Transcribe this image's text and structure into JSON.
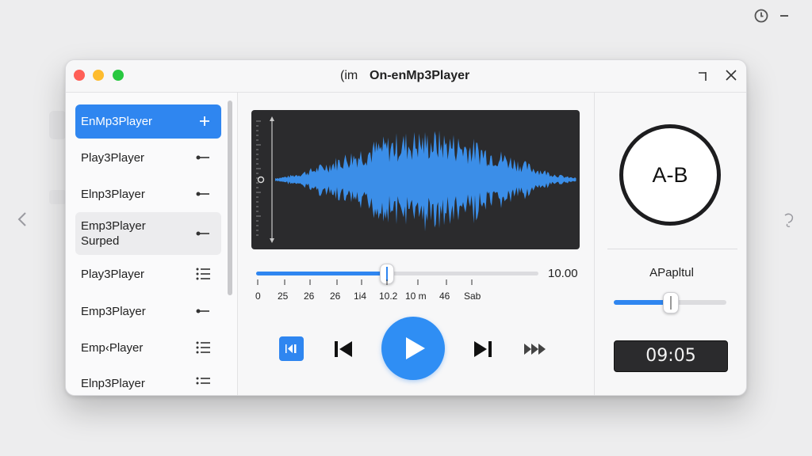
{
  "window": {
    "title_prefix": "(im",
    "title": "On-enMp3Player"
  },
  "sidebar": {
    "items": [
      {
        "label": "EnMp3Player",
        "icon": "plus-icon",
        "state": "active"
      },
      {
        "label": "Play3Player",
        "icon": "dash-dot-icon",
        "state": "normal"
      },
      {
        "label": "Elnp3Player",
        "icon": "dash-dot-icon",
        "state": "normal"
      },
      {
        "label": "Emp3Player\nSurped",
        "icon": "dash-dot-icon",
        "state": "hover"
      },
      {
        "label": "Play3Player",
        "icon": "list-icon",
        "state": "normal"
      },
      {
        "label": "Emp3Player",
        "icon": "dash-dot-icon",
        "state": "normal"
      },
      {
        "label": "Emp‹Player",
        "icon": "list-icon",
        "state": "normal"
      },
      {
        "label": "Elnp3Player",
        "icon": "list-icon",
        "state": "normal"
      }
    ]
  },
  "player": {
    "seek_time": "10.00",
    "seek_progress": 0.46,
    "tick_labels": [
      "0",
      "25",
      "26",
      "26",
      "1i4",
      "10.2",
      "10 m",
      "46",
      "Sab"
    ]
  },
  "ab_panel": {
    "ab_label": "A-B",
    "amplitude_label": "APapltul",
    "amplitude_level": 0.5,
    "time_display": "09:05"
  },
  "colors": {
    "accent": "#2f86f0",
    "waveform": "#3b8ee8",
    "panel_dark": "#2b2b2d",
    "close": "#ff5f57",
    "minimize": "#febc2e",
    "maximize": "#28c840"
  }
}
